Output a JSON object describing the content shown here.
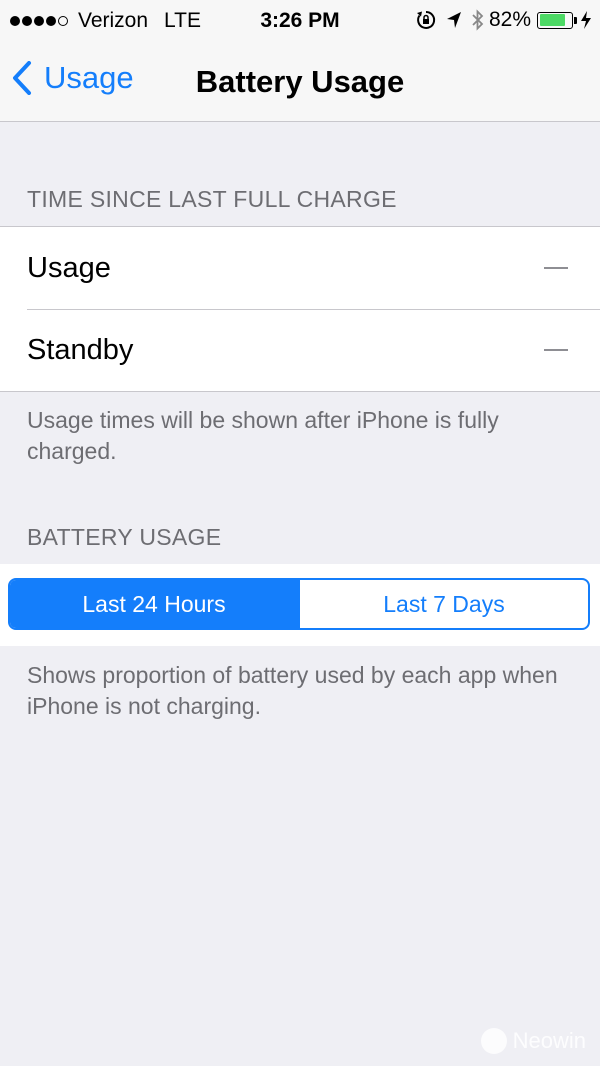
{
  "status_bar": {
    "carrier": "Verizon",
    "network": "LTE",
    "time": "3:26 PM",
    "battery_percent": "82%",
    "battery_level": 0.82,
    "battery_color": "#4cd964",
    "icons": [
      "rotation-lock-icon",
      "location-arrow-icon",
      "bluetooth-icon",
      "battery-icon",
      "charging-bolt-icon"
    ]
  },
  "nav": {
    "back_label": "Usage",
    "title": "Battery Usage"
  },
  "sections": {
    "time_since_charge": {
      "header": "TIME SINCE LAST FULL CHARGE",
      "rows": [
        {
          "label": "Usage",
          "value": "—"
        },
        {
          "label": "Standby",
          "value": "—"
        }
      ],
      "footer": "Usage times will be shown after iPhone is fully charged."
    },
    "battery_usage": {
      "header": "BATTERY USAGE",
      "segments": [
        "Last 24 Hours",
        "Last 7 Days"
      ],
      "selected_segment": "Last 24 Hours",
      "footer": "Shows proportion of battery used by each app when iPhone is not charging."
    }
  },
  "colors": {
    "accent": "#147efb",
    "background": "#efeff4",
    "secondary_text": "#6d6d72"
  },
  "watermark": {
    "text": "Neowin"
  }
}
